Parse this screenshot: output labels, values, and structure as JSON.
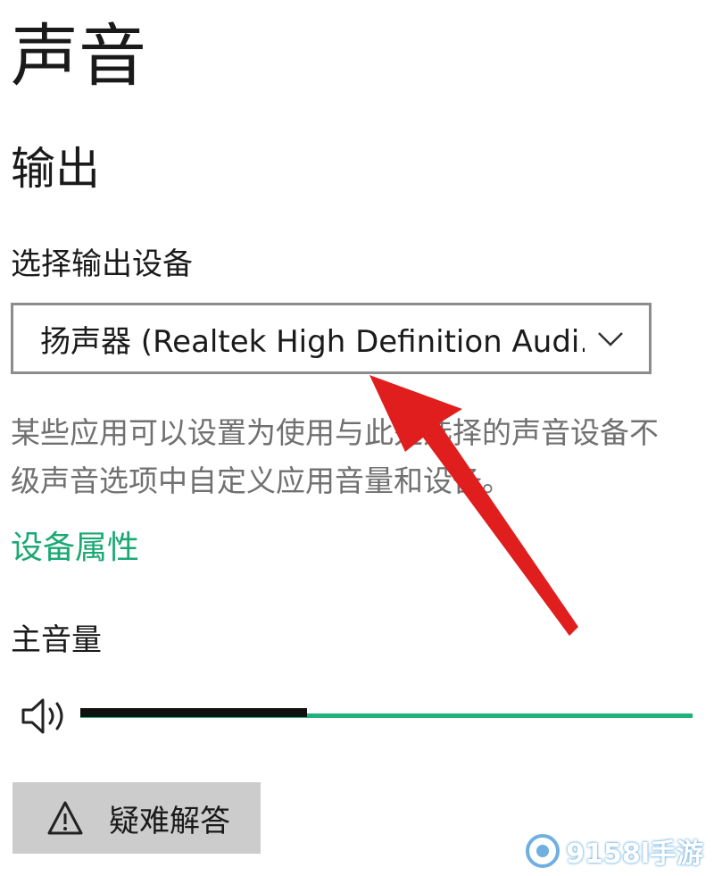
{
  "page": {
    "title": "声音"
  },
  "output": {
    "section_title": "输出",
    "device_label": "选择输出设备",
    "device_value": "扬声器 (Realtek High Definition Audi...",
    "description_line1": "某些应用可以设置为使用与此处选择的声音设备不",
    "description_line2": "级声音选项中自定义应用音量和设备。",
    "device_properties_link": "设备属性"
  },
  "volume": {
    "label": "主音量",
    "level_fraction": 0.37
  },
  "troubleshoot": {
    "label": "疑难解答"
  },
  "watermark": {
    "text": "9158l手游"
  },
  "colors": {
    "accent_green": "#1aa874",
    "slider_track": "#1fb37a",
    "arrow_red": "#e01e1e",
    "button_bg": "#cccccc"
  },
  "icons": {
    "speaker": "speaker-icon",
    "chevron": "chevron-down-icon",
    "warning": "warning-icon"
  }
}
